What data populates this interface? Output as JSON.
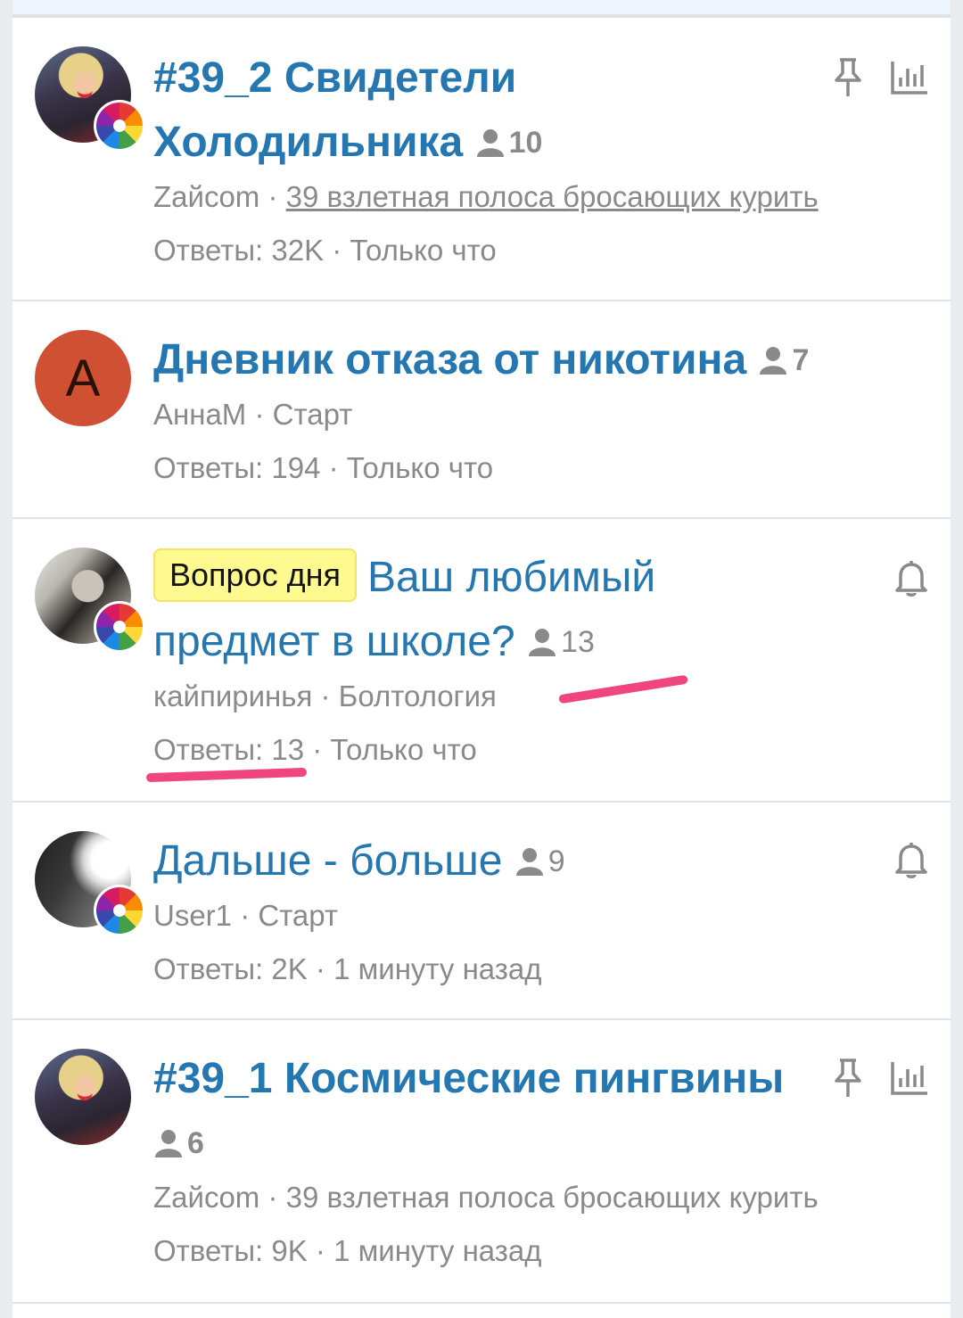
{
  "threads": [
    {
      "title_a": "#39_2 Свидетели",
      "title_b": "Холодильника",
      "participants": "10",
      "author": "Zaйcom",
      "forum": "39 взлетная полоса бросающих курить",
      "replies": "Ответы: 32K",
      "time": "Только что",
      "icons": [
        "pin-icon",
        "poll-icon"
      ]
    },
    {
      "avatar_letter": "A",
      "title": "Дневник отказа от никотина",
      "participants": "7",
      "author": "АннаМ",
      "forum": "Старт",
      "replies": "Ответы: 194",
      "time": "Только что"
    },
    {
      "prefix": "Вопрос дня",
      "title_a": "Ваш любимый",
      "title_b": "предмет в школе?",
      "participants": "13",
      "author": "кайпиринья",
      "forum": "Болтология",
      "replies": "Ответы: 13",
      "time": "Только что",
      "icons": [
        "bell-icon"
      ]
    },
    {
      "title": "Дальше - больше",
      "participants": "9",
      "author": "User1",
      "forum": "Старт",
      "replies": "Ответы: 2K",
      "time": "1 минуту назад",
      "icons": [
        "bell-icon"
      ]
    },
    {
      "title": "#39_1 Космические пингвины",
      "participants": "6",
      "author": "Zaйcom",
      "forum": "39 взлетная полоса бросающих курить",
      "replies": "Ответы: 9K",
      "time": "1 минуту назад",
      "icons": [
        "pin-icon",
        "poll-icon"
      ]
    }
  ],
  "separator": " · ",
  "colors": {
    "title": "#2577b1",
    "meta": "#8a8a8a",
    "prefix_bg": "#fffa90",
    "annotation": "#f0467e"
  }
}
